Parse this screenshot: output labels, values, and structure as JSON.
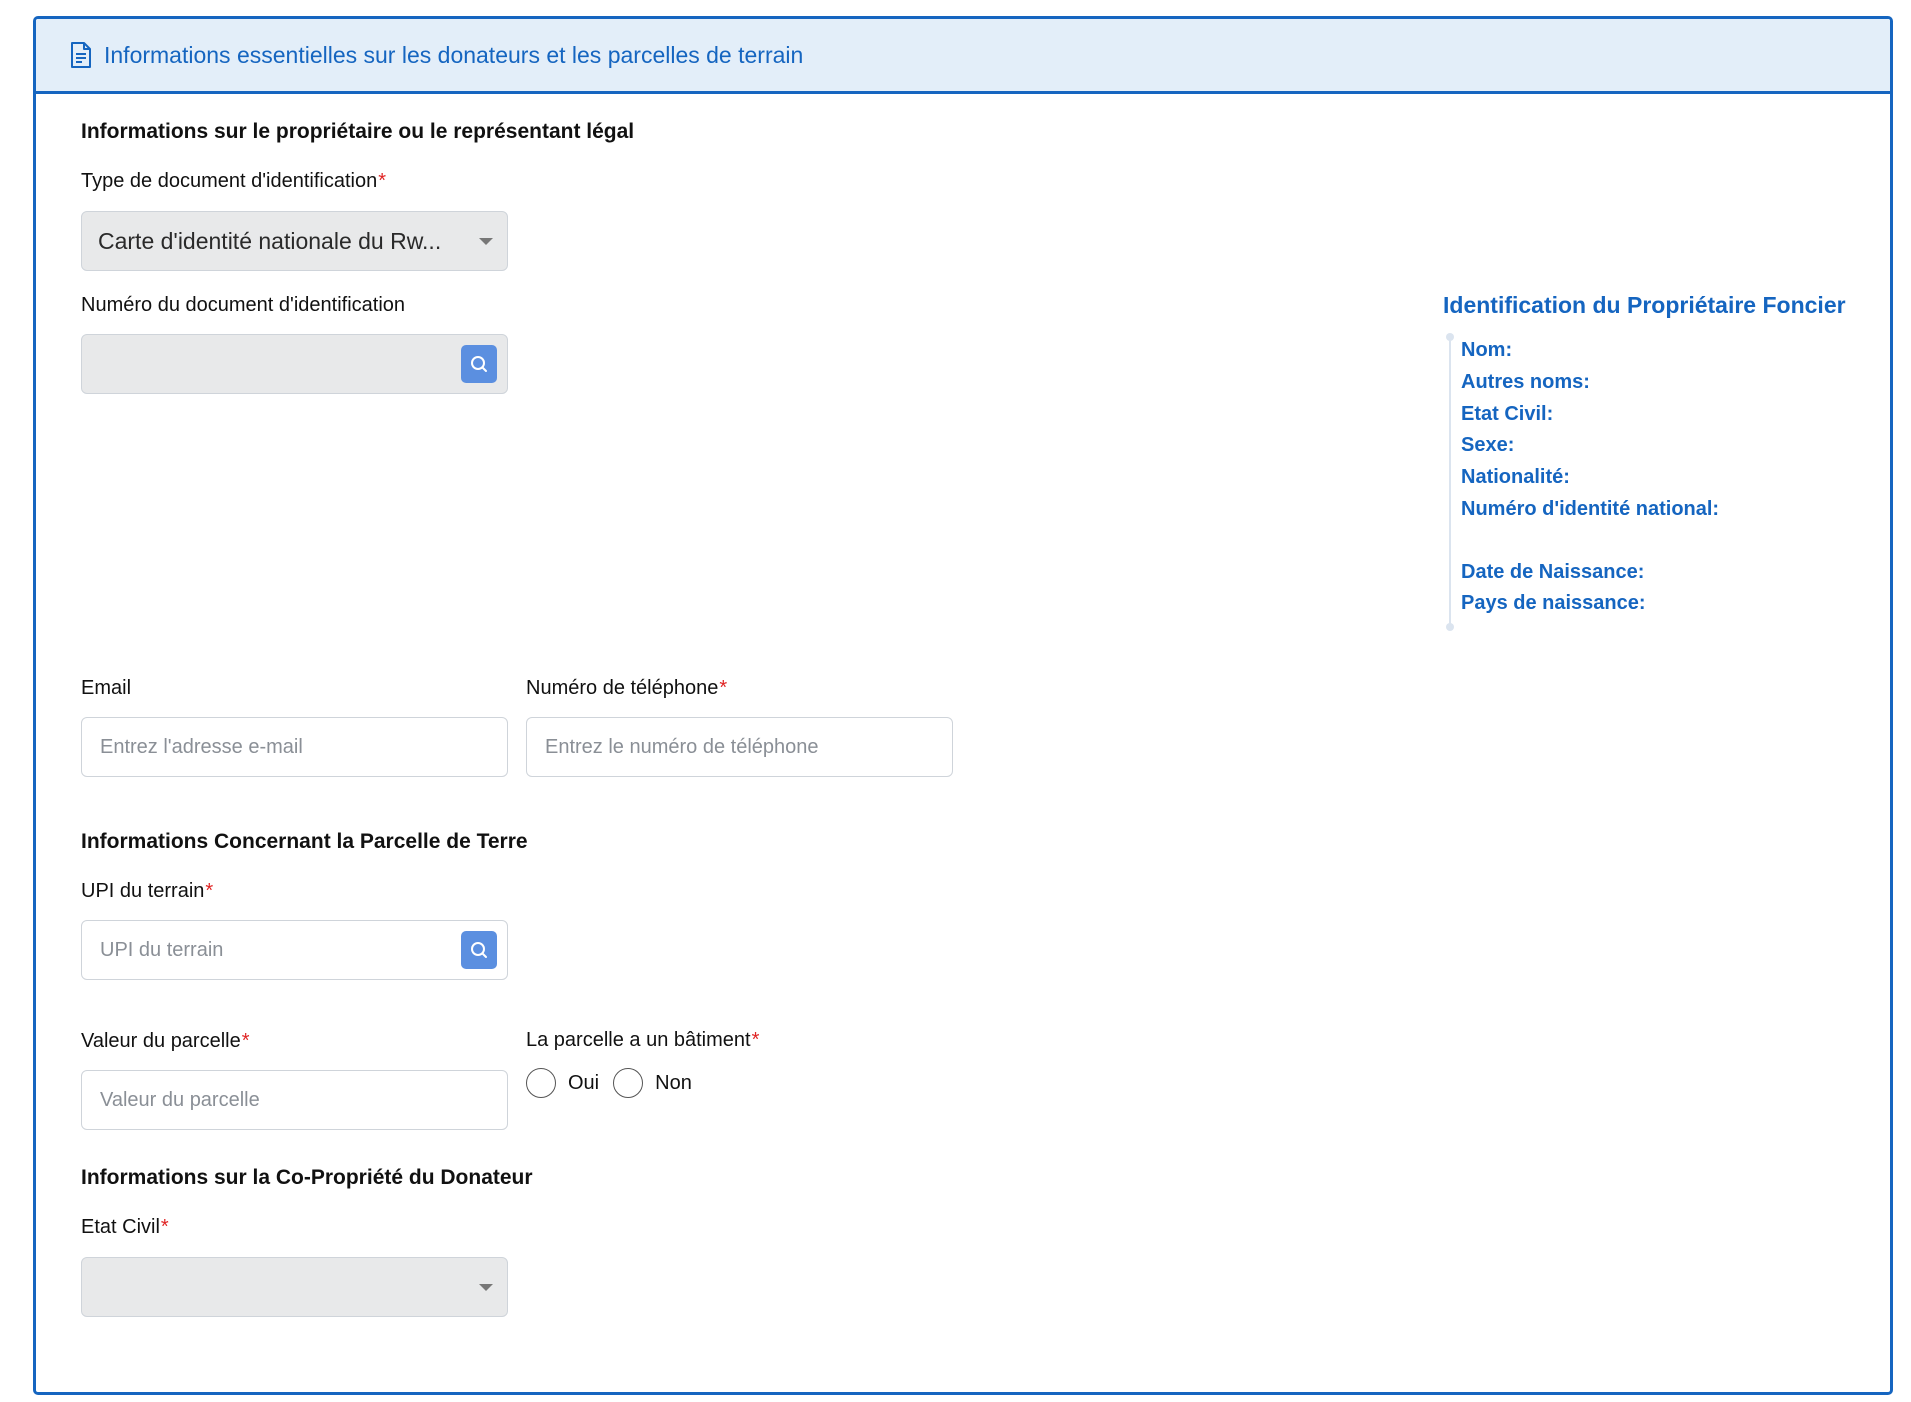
{
  "header": {
    "title": "Informations essentielles sur les donateurs et les parcelles de terrain",
    "icon": "document-icon"
  },
  "owner_section": {
    "title": "Informations sur le propriétaire ou le représentant légal",
    "doc_type_label": "Type de document d'identification",
    "doc_type_value": "Carte d'identité nationale du Rw...",
    "doc_number_label": "Numéro du document d'identification",
    "doc_number_value": "",
    "email_label": "Email",
    "email_placeholder": "Entrez l'adresse e-mail",
    "phone_label": "Numéro de téléphone",
    "phone_placeholder": "Entrez le numéro de téléphone"
  },
  "parcel_section": {
    "title": "Informations Concernant la Parcelle de Terre",
    "upi_label": "UPI du terrain",
    "upi_placeholder": "UPI du terrain",
    "value_label": "Valeur du parcelle",
    "value_placeholder": "Valeur du parcelle",
    "building_label": "La parcelle a un bâtiment",
    "option_yes": "Oui",
    "option_no": "Non"
  },
  "coowner_section": {
    "title": "Informations sur la Co-Propriété du Donateur",
    "civil_status_label": "Etat Civil",
    "civil_status_value": ""
  },
  "identification_panel": {
    "title": "Identification du Propriétaire Foncier",
    "fields": {
      "nom": "Nom:",
      "autres_noms": "Autres noms:",
      "etat_civil": "Etat Civil:",
      "sexe": "Sexe:",
      "nationalite": "Nationalité:",
      "numero_identite": "Numéro d'identité national:",
      "date_naissance": "Date de Naissance:",
      "pays_naissance": "Pays de naissance:"
    }
  },
  "required_marker": "*",
  "colors": {
    "primary": "#1565c0",
    "header_bg": "#e3eef9",
    "required": "#e02424",
    "search_button": "#5b8fe0"
  }
}
